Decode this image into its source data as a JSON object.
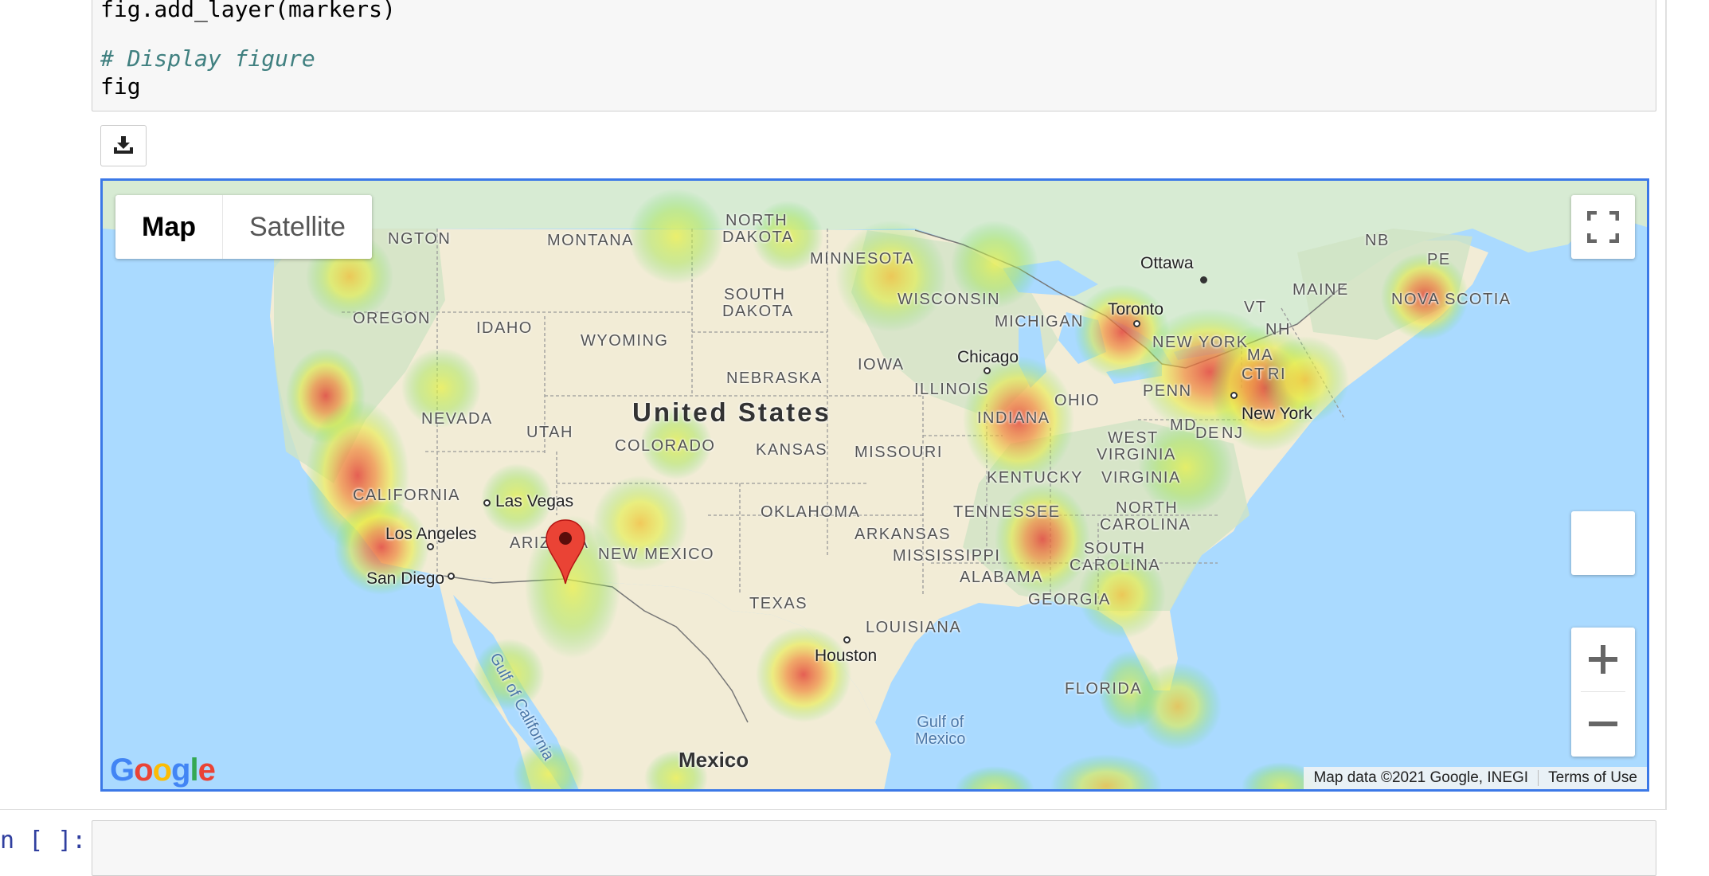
{
  "code_cell": {
    "lines": [
      "fig.add_layer(markers)",
      "",
      "# Display figure",
      "fig"
    ]
  },
  "download_button": {
    "icon": "download-icon"
  },
  "map": {
    "map_type_control": {
      "map_label": "Map",
      "satellite_label": "Satellite"
    },
    "fullscreen_icon": "fullscreen-icon",
    "zoom_in_icon": "plus-icon",
    "zoom_out_icon": "minus-icon",
    "logo_text": "Google",
    "attribution": "Map data ©2021 Google, INEGI",
    "terms_link": "Terms of Use",
    "country_label": "United States",
    "mexico_label": "Mexico",
    "water_labels": {
      "gulf_mexico_1": "Gulf of",
      "gulf_mexico_2": "Mexico",
      "gulf_california": "Gulf of California"
    },
    "state_labels": {
      "washington": "NGTON",
      "montana": "MONTANA",
      "north_dakota_1": "NORTH",
      "north_dakota_2": "DAKOTA",
      "minnesota": "MINNESOTA",
      "oregon": "OREGON",
      "idaho": "IDAHO",
      "south_dakota_1": "SOUTH",
      "south_dakota_2": "DAKOTA",
      "wisconsin": "WISCONSIN",
      "wyoming": "WYOMING",
      "michigan": "MICHIGAN",
      "iowa": "IOWA",
      "nebraska": "NEBRASKA",
      "illinois": "ILLINOIS",
      "nevada": "NEVADA",
      "utah": "UTAH",
      "colorado": "COLORADO",
      "indiana": "INDIANA",
      "ohio": "OHIO",
      "kansas": "KANSAS",
      "missouri": "MISSOURI",
      "west_virginia_1": "WEST",
      "west_virginia_2": "VIRGINIA",
      "kentucky": "KENTUCKY",
      "virginia": "VIRGINIA",
      "california": "CALIFORNIA",
      "tennessee": "TENNESSEE",
      "north_carolina_1": "NORTH",
      "north_carolina_2": "CAROLINA",
      "oklahoma": "OKLAHOMA",
      "arkansas": "ARKANSAS",
      "arizona": "ARIZONA",
      "new_mexico": "NEW MEXICO",
      "mississippi": "MISSISSIPPI",
      "alabama": "ALABAMA",
      "south_carolina_1": "SOUTH",
      "south_carolina_2": "CAROLINA",
      "georgia": "GEORGIA",
      "texas": "TEXAS",
      "louisiana": "LOUISIANA",
      "florida": "FLORIDA",
      "new_york": "NEW YORK",
      "penn": "PENN",
      "md": "MD",
      "de": "DE",
      "nj": "NJ",
      "ma": "MA",
      "ct": "CT",
      "ri": "RI",
      "nh": "NH",
      "vt": "VT",
      "maine": "MAINE",
      "nb": "NB",
      "pe": "PE",
      "nova_scotia": "NOVA SCOTIA"
    },
    "city_labels": {
      "ottawa": "Ottawa",
      "toronto": "Toronto",
      "chicago": "Chicago",
      "new_york": "New York",
      "las_vegas": "Las Vegas",
      "los_angeles": "Los Angeles",
      "san_diego": "San Diego",
      "houston": "Houston"
    },
    "marker_icon": "map-pin-icon"
  },
  "next_cell": {
    "prompt": "n [ ]:"
  }
}
